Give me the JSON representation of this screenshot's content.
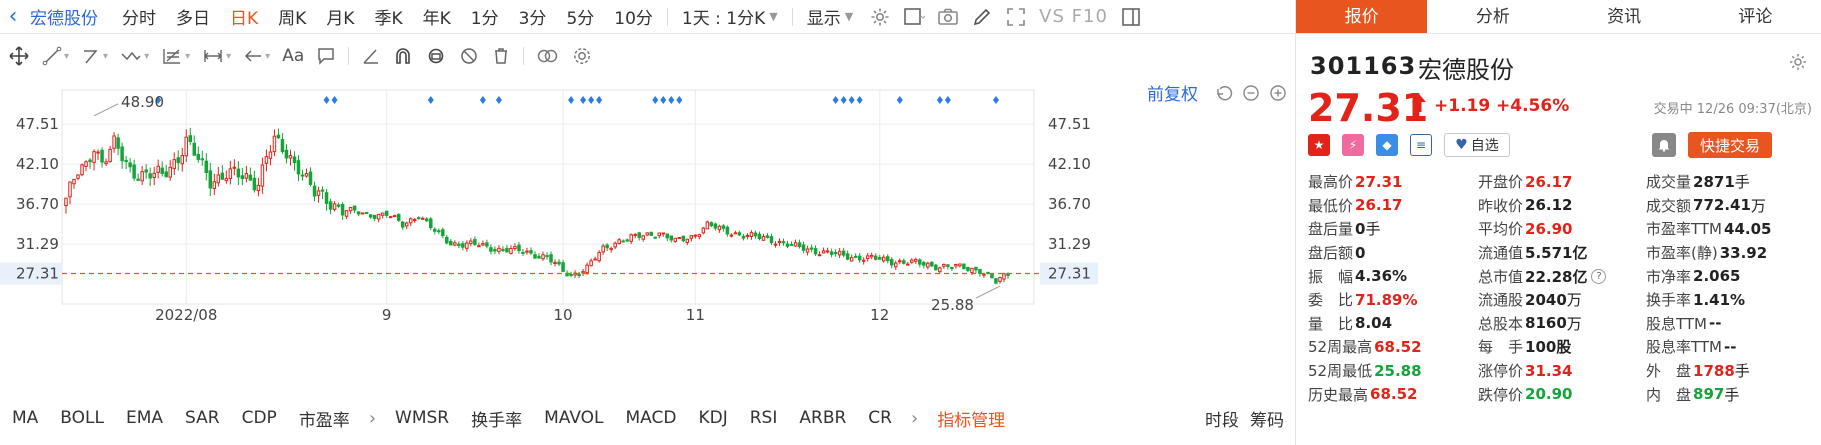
{
  "tabbar": {
    "stock_name": "宏德股份",
    "tabs": [
      "分时",
      "多日",
      "日K",
      "周K",
      "月K",
      "季K",
      "年K",
      "1分",
      "3分",
      "5分",
      "10分"
    ],
    "active_tab": "日K",
    "period_select": "1天 : 1分K",
    "display_label": "显示",
    "vs_label": "VS F10"
  },
  "toolbar": {
    "text_tool": "Aa"
  },
  "chart": {
    "adjust_label": "前复权",
    "colors": {
      "up": "#e2231a",
      "down": "#13a538",
      "grid": "#ececec",
      "price_line": "#e8551f",
      "marker": "#2b7be4"
    }
  },
  "chart_data": {
    "type": "candlestick",
    "y_ticks": [
      "47.51",
      "42.10",
      "36.70",
      "31.29"
    ],
    "y_ticks_right": [
      "47.51",
      "42.10",
      "36.70",
      "31.29"
    ],
    "ylim": [
      24.0,
      50.5
    ],
    "x_labels": [
      {
        "text": "2022/08",
        "index": 30
      },
      {
        "text": "9",
        "index": 80
      },
      {
        "text": "10",
        "index": 124
      },
      {
        "text": "11",
        "index": 157
      },
      {
        "text": "12",
        "index": 203
      }
    ],
    "current_price": "27.31",
    "current_price_value": 27.31,
    "max_label": "48.90",
    "max_index": 7,
    "min_label": "25.88",
    "min_index": 234,
    "marker_indices": [
      23,
      65,
      67,
      91,
      104,
      108,
      126,
      129,
      131,
      133,
      147,
      149,
      151,
      153,
      192,
      194,
      196,
      198,
      208,
      218,
      220,
      232
    ],
    "close_anchors": [
      [
        0,
        37.5
      ],
      [
        3,
        40.8
      ],
      [
        5,
        41.8
      ],
      [
        7,
        44.8
      ],
      [
        9,
        42.4
      ],
      [
        12,
        44.6
      ],
      [
        16,
        41.4
      ],
      [
        20,
        40.6
      ],
      [
        24,
        40.5
      ],
      [
        28,
        43.2
      ],
      [
        30,
        45.2
      ],
      [
        32,
        43.4
      ],
      [
        36,
        40.0
      ],
      [
        40,
        40.8
      ],
      [
        44,
        40.3
      ],
      [
        48,
        39.8
      ],
      [
        50,
        43.2
      ],
      [
        52,
        45.0
      ],
      [
        55,
        43.5
      ],
      [
        58,
        42.0
      ],
      [
        62,
        38.0
      ],
      [
        66,
        37.0
      ],
      [
        70,
        35.9
      ],
      [
        75,
        35.2
      ],
      [
        80,
        35.4
      ],
      [
        84,
        33.8
      ],
      [
        88,
        35.3
      ],
      [
        92,
        33.0
      ],
      [
        96,
        31.4
      ],
      [
        102,
        31.2
      ],
      [
        108,
        30.6
      ],
      [
        114,
        30.3
      ],
      [
        120,
        29.5
      ],
      [
        124,
        27.6
      ],
      [
        126,
        27.1
      ],
      [
        130,
        28.1
      ],
      [
        134,
        30.6
      ],
      [
        138,
        31.8
      ],
      [
        144,
        32.4
      ],
      [
        148,
        32.9
      ],
      [
        152,
        31.6
      ],
      [
        156,
        32.3
      ],
      [
        160,
        33.9
      ],
      [
        164,
        33.1
      ],
      [
        170,
        32.4
      ],
      [
        176,
        31.9
      ],
      [
        182,
        30.9
      ],
      [
        188,
        30.3
      ],
      [
        194,
        29.7
      ],
      [
        200,
        29.4
      ],
      [
        206,
        29.0
      ],
      [
        212,
        28.7
      ],
      [
        218,
        28.3
      ],
      [
        224,
        28.1
      ],
      [
        228,
        27.8
      ],
      [
        232,
        26.1
      ],
      [
        235,
        27.31
      ]
    ]
  },
  "indicators": {
    "items": [
      "MA",
      "BOLL",
      "EMA",
      "SAR",
      "CDP",
      "市盈率",
      "WMSR",
      "换手率",
      "MAVOL",
      "MACD",
      "KDJ",
      "RSI",
      "ARBR",
      "CR"
    ],
    "manage": "指标管理",
    "right": [
      "时段",
      "筹码"
    ]
  },
  "quote": {
    "tabs": [
      "报价",
      "分析",
      "资讯",
      "评论"
    ],
    "active_tab": "报价",
    "code": "301163",
    "name": "宏德股份",
    "price": "27.31",
    "change": "+1.19",
    "change_pct": "+4.56%",
    "status": "交易中 12/26 09:37(北京)",
    "fav_label": "自选",
    "trade_label": "快捷交易",
    "rows": [
      [
        {
          "l": "最高价",
          "v": "27.31",
          "c": "red"
        },
        {
          "l": "开盘价",
          "v": "26.17",
          "c": "red"
        },
        {
          "l": "成交量",
          "v": "2871",
          "u": "手",
          "c": "dark"
        }
      ],
      [
        {
          "l": "最低价",
          "v": "26.17",
          "c": "red"
        },
        {
          "l": "昨收价",
          "v": "26.12",
          "c": "dark"
        },
        {
          "l": "成交额",
          "v": "772.41",
          "u": "万",
          "c": "dark"
        }
      ],
      [
        {
          "l": "盘后量",
          "v": "0",
          "u": "手",
          "c": "dark"
        },
        {
          "l": "平均价",
          "v": "26.90",
          "c": "red"
        },
        {
          "l": "市盈率TTM",
          "v": "44.05",
          "c": "dark"
        }
      ],
      [
        {
          "l": "盘后额",
          "v": "0",
          "c": "dark"
        },
        {
          "l": "流通值",
          "v": "5.571亿",
          "c": "dark"
        },
        {
          "l": "市盈率(静)",
          "v": "33.92",
          "c": "dark"
        }
      ],
      [
        {
          "l": "振　幅",
          "v": "4.36%",
          "c": "dark"
        },
        {
          "l": "总市值",
          "v": "22.28亿",
          "c": "dark",
          "q": true
        },
        {
          "l": "市净率",
          "v": "2.065",
          "c": "dark"
        }
      ],
      [
        {
          "l": "委　比",
          "v": "71.89%",
          "c": "red"
        },
        {
          "l": "流通股",
          "v": "2040",
          "u": "万",
          "c": "dark"
        },
        {
          "l": "换手率",
          "v": "1.41%",
          "c": "dark"
        }
      ],
      [
        {
          "l": "量　比",
          "v": "8.04",
          "c": "dark"
        },
        {
          "l": "总股本",
          "v": "8160",
          "u": "万",
          "c": "dark"
        },
        {
          "l": "股息TTM",
          "v": "--",
          "c": "dark"
        }
      ],
      [
        {
          "l": "52周最高",
          "v": "68.52",
          "c": "red"
        },
        {
          "l": "每　手",
          "v": "100股",
          "c": "dark"
        },
        {
          "l": "股息率TTM",
          "v": "--",
          "c": "dark"
        }
      ],
      [
        {
          "l": "52周最低",
          "v": "25.88",
          "c": "green"
        },
        {
          "l": "涨停价",
          "v": "31.34",
          "c": "red"
        },
        {
          "l": "外　盘",
          "v": "1788",
          "u": "手",
          "c": "red"
        }
      ],
      [
        {
          "l": "历史最高",
          "v": "68.52",
          "c": "red"
        },
        {
          "l": "跌停价",
          "v": "20.90",
          "c": "green"
        },
        {
          "l": "内　盘",
          "v": "897",
          "u": "手",
          "c": "green"
        }
      ]
    ]
  }
}
